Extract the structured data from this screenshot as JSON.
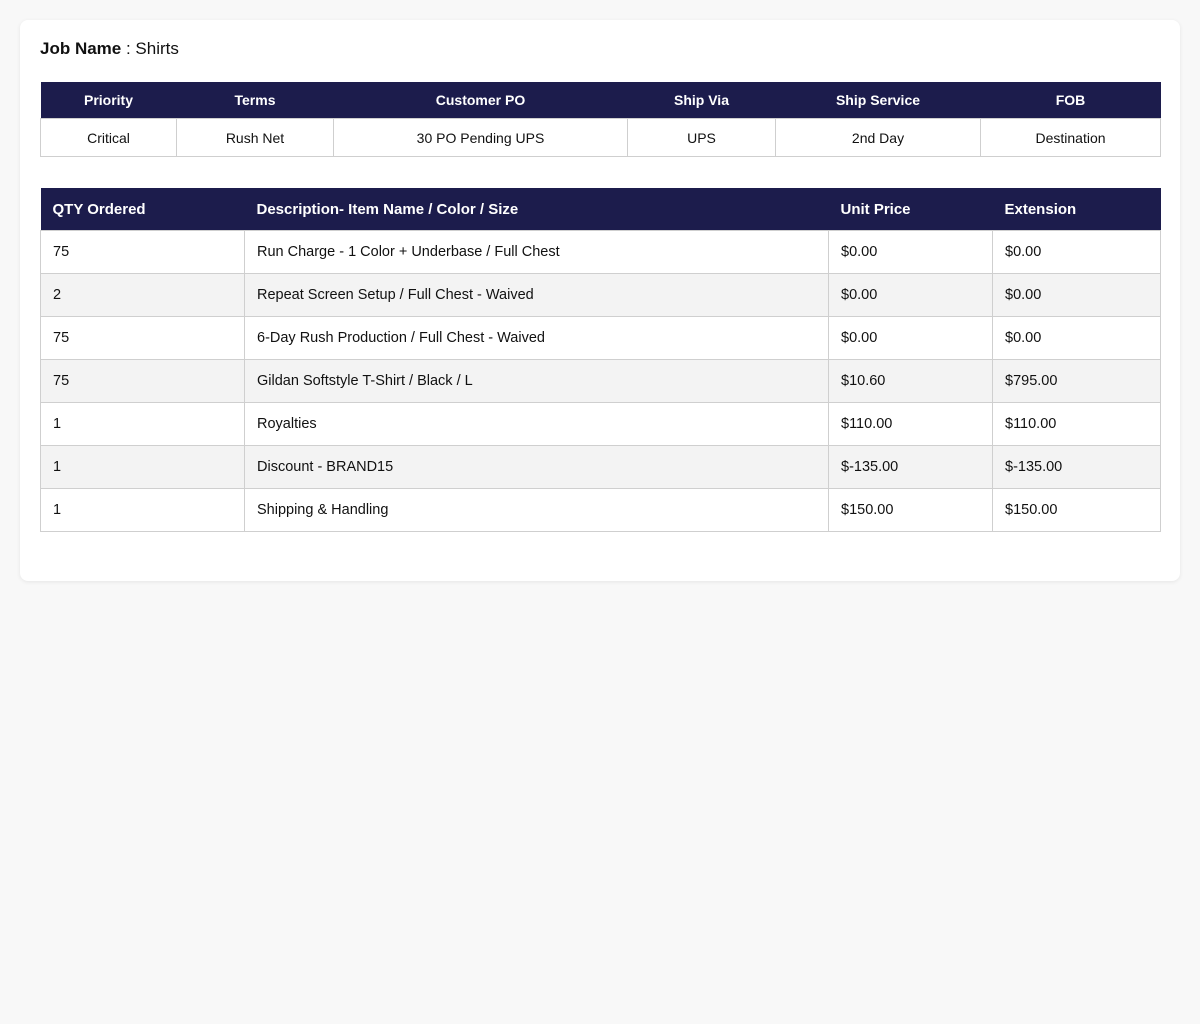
{
  "job": {
    "label": "Job Name",
    "separator": " : ",
    "value": "Shirts"
  },
  "summary": {
    "headers": [
      "Priority",
      "Terms",
      "Customer PO",
      "Ship Via",
      "Ship Service",
      "FOB"
    ],
    "values": [
      "Critical",
      "Rush Net",
      "30 PO Pending UPS",
      "UPS",
      "2nd Day",
      "Destination"
    ]
  },
  "items": {
    "headers": [
      "QTY Ordered",
      "Description- Item Name / Color / Size",
      "Unit Price",
      "Extension"
    ],
    "rows": [
      {
        "qty": "75",
        "desc": "Run Charge - 1 Color + Underbase / Full Chest",
        "unit": "$0.00",
        "ext": "$0.00"
      },
      {
        "qty": "2",
        "desc": "Repeat Screen Setup / Full Chest - Waived",
        "unit": "$0.00",
        "ext": "$0.00"
      },
      {
        "qty": "75",
        "desc": "6-Day Rush Production / Full Chest - Waived",
        "unit": "$0.00",
        "ext": "$0.00"
      },
      {
        "qty": "75",
        "desc": "Gildan Softstyle T-Shirt / Black / L",
        "unit": "$10.60",
        "ext": "$795.00"
      },
      {
        "qty": "1",
        "desc": "Royalties",
        "unit": "$110.00",
        "ext": "$110.00"
      },
      {
        "qty": "1",
        "desc": "Discount - BRAND15",
        "unit": "$-135.00",
        "ext": "$-135.00"
      },
      {
        "qty": "1",
        "desc": "Shipping & Handling",
        "unit": "$150.00",
        "ext": "$150.00"
      }
    ]
  },
  "colors": {
    "header_bg": "#1c1c4c",
    "header_text": "#ffffff",
    "alt_row_bg": "#f3f3f3",
    "page_bg": "#f8f8f8"
  }
}
